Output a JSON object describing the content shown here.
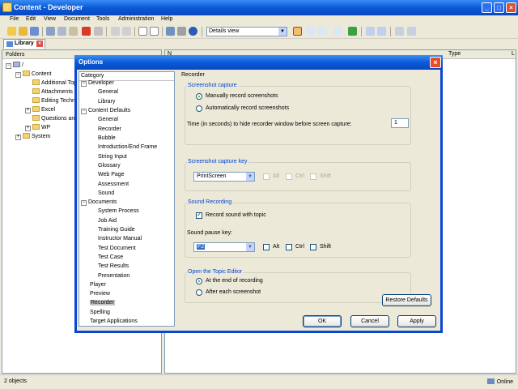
{
  "window": {
    "title": "Content - Developer"
  },
  "menu": [
    "File",
    "Edit",
    "View",
    "Document",
    "Tools",
    "Administration",
    "Help"
  ],
  "toolbar": {
    "view_select": "Details view"
  },
  "library": {
    "tab_label": "Library",
    "folders_header": "Folders",
    "tree": [
      {
        "label": "/",
        "indent": 0
      },
      {
        "label": "Content",
        "indent": 1
      },
      {
        "label": "Additional Top",
        "indent": 2
      },
      {
        "label": "Attachments",
        "indent": 2
      },
      {
        "label": "Editing Techni",
        "indent": 2
      },
      {
        "label": "Excel",
        "indent": 2
      },
      {
        "label": "Questions and",
        "indent": 2
      },
      {
        "label": "WP",
        "indent": 2
      },
      {
        "label": "System",
        "indent": 1
      }
    ],
    "columns": {
      "name": "N",
      "type": "Type",
      "last": "L"
    }
  },
  "status": {
    "objects": "2 objects",
    "connection": "Online"
  },
  "dialog": {
    "title": "Options",
    "category_header": "Category",
    "categories": [
      {
        "label": "Developer",
        "level": 0
      },
      {
        "label": "General",
        "level": 1
      },
      {
        "label": "Library",
        "level": 1
      },
      {
        "label": "Content Defaults",
        "level": 0
      },
      {
        "label": "General",
        "level": 1
      },
      {
        "label": "Recorder",
        "level": 1
      },
      {
        "label": "Bubble",
        "level": 1
      },
      {
        "label": "Introduction/End Frame",
        "level": 1
      },
      {
        "label": "String Input",
        "level": 1
      },
      {
        "label": "Glossary",
        "level": 1
      },
      {
        "label": "Web Page",
        "level": 1
      },
      {
        "label": "Assessment",
        "level": 1
      },
      {
        "label": "Sound",
        "level": 1
      },
      {
        "label": "Documents",
        "level": 0
      },
      {
        "label": "System Process",
        "level": 1
      },
      {
        "label": "Job Aid",
        "level": 1
      },
      {
        "label": "Training Guide",
        "level": 1
      },
      {
        "label": "Instructor Manual",
        "level": 1
      },
      {
        "label": "Test Document",
        "level": 1
      },
      {
        "label": "Test Case",
        "level": 1
      },
      {
        "label": "Test Results",
        "level": 1
      },
      {
        "label": "Presentation",
        "level": 1
      },
      {
        "label": "Player",
        "level": 0
      },
      {
        "label": "Preview",
        "level": 0
      },
      {
        "label": "Recorder",
        "level": 0
      },
      {
        "label": "Spelling",
        "level": 0
      },
      {
        "label": "Target Applications",
        "level": 0
      }
    ],
    "selected_category": "Recorder",
    "section_title": "Recorder",
    "screenshot_capture": {
      "title": "Screenshot capture",
      "manual": "Manually record screenshots",
      "automatic": "Automatically record screenshots",
      "hide_label": "Time (in seconds) to hide recorder window before screen capture:",
      "hide_value": "1"
    },
    "capture_key": {
      "title": "Screenshot capture key",
      "key": "PrintScreen",
      "alt": "Alt",
      "ctrl": "Ctrl",
      "shift": "Shift"
    },
    "sound": {
      "title": "Sound Recording",
      "record_label": "Record sound with topic",
      "pause_label": "Sound pause key:",
      "pause_key": "F2",
      "alt": "Alt",
      "ctrl": "Ctrl",
      "shift": "Shift"
    },
    "topic_editor": {
      "title": "Open the Topic Editor",
      "end": "At the end of recording",
      "after": "After each screenshot"
    },
    "buttons": {
      "restore": "Restore Defaults",
      "ok": "OK",
      "cancel": "Cancel",
      "apply": "Apply"
    }
  }
}
